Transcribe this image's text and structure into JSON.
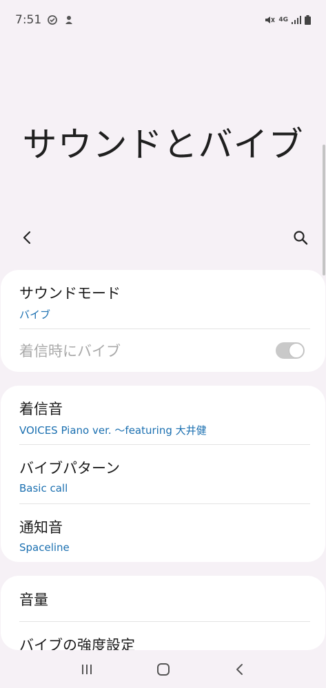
{
  "status_bar": {
    "time": "7:51",
    "left_icons": [
      "sync-check-icon",
      "assistant-icon"
    ],
    "right_icons": [
      "mute-vibrate-icon",
      "4g-icon",
      "signal-icon",
      "battery-icon"
    ],
    "network": "4G"
  },
  "page": {
    "title": "サウンドとバイブ"
  },
  "toolbar": {
    "back_icon": "back-arrow-icon",
    "search_icon": "search-icon"
  },
  "sections": {
    "sound_mode": {
      "title": "サウンドモード",
      "value": "バイブ"
    },
    "vibrate_on_ring": {
      "title": "着信時にバイブ",
      "toggle_on": true,
      "disabled": true
    },
    "ringtone": {
      "title": "着信音",
      "value": "VOICES Piano ver. 〜featuring 大井健"
    },
    "vibration_pattern": {
      "title": "バイブパターン",
      "value": "Basic call"
    },
    "notification_sound": {
      "title": "通知音",
      "value": "Spaceline"
    },
    "volume": {
      "title": "音量"
    },
    "vibration_intensity": {
      "title": "バイブの強度設定"
    }
  },
  "colors": {
    "accent": "#1a6fb0",
    "background": "#f6f1f6",
    "card": "#ffffff"
  }
}
